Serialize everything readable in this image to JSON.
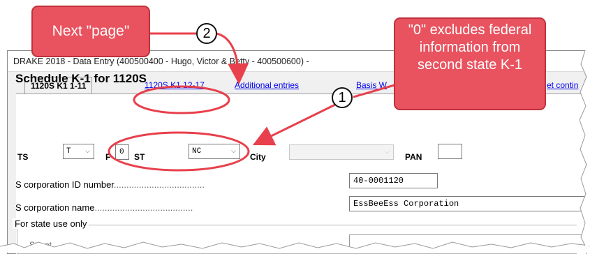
{
  "window": {
    "title": "DRAKE 2018 - Data Entry (400500400 - Hugo, Victor & Betty - 400500600) -"
  },
  "tabs": [
    {
      "label": "1120S K1  1-11"
    },
    {
      "label": "1120S K1 12-17"
    },
    {
      "label": "Additional entries"
    },
    {
      "label": "Basis W"
    },
    {
      "label": "et contin"
    }
  ],
  "form": {
    "heading": "Schedule K-1 for 1120S",
    "ts_label": "TS",
    "ts_value": "T",
    "f_label": "F",
    "f_value": "0",
    "st_label": "ST",
    "st_value": "NC",
    "city_label": "City",
    "city_value": "",
    "pan_label": "PAN",
    "pan_value": "",
    "scorp_id_label": "S corporation ID number",
    "scorp_id_value": "40-0001120",
    "scorp_name_label": "S corporation name",
    "scorp_name_value": "EssBeeEss Corporation",
    "state_use_label": "For state use only",
    "street_label": "Street"
  },
  "annotations": {
    "callout_next_page": "Next \"page\"",
    "callout_excludes": "\"0\" excludes federal information from second state K-1",
    "marker_1": "1",
    "marker_2": "2"
  },
  "colors": {
    "callout_fill": "#e8535f",
    "callout_border": "#c0303c",
    "arrow": "#e8404c",
    "link": "#0000ee"
  }
}
